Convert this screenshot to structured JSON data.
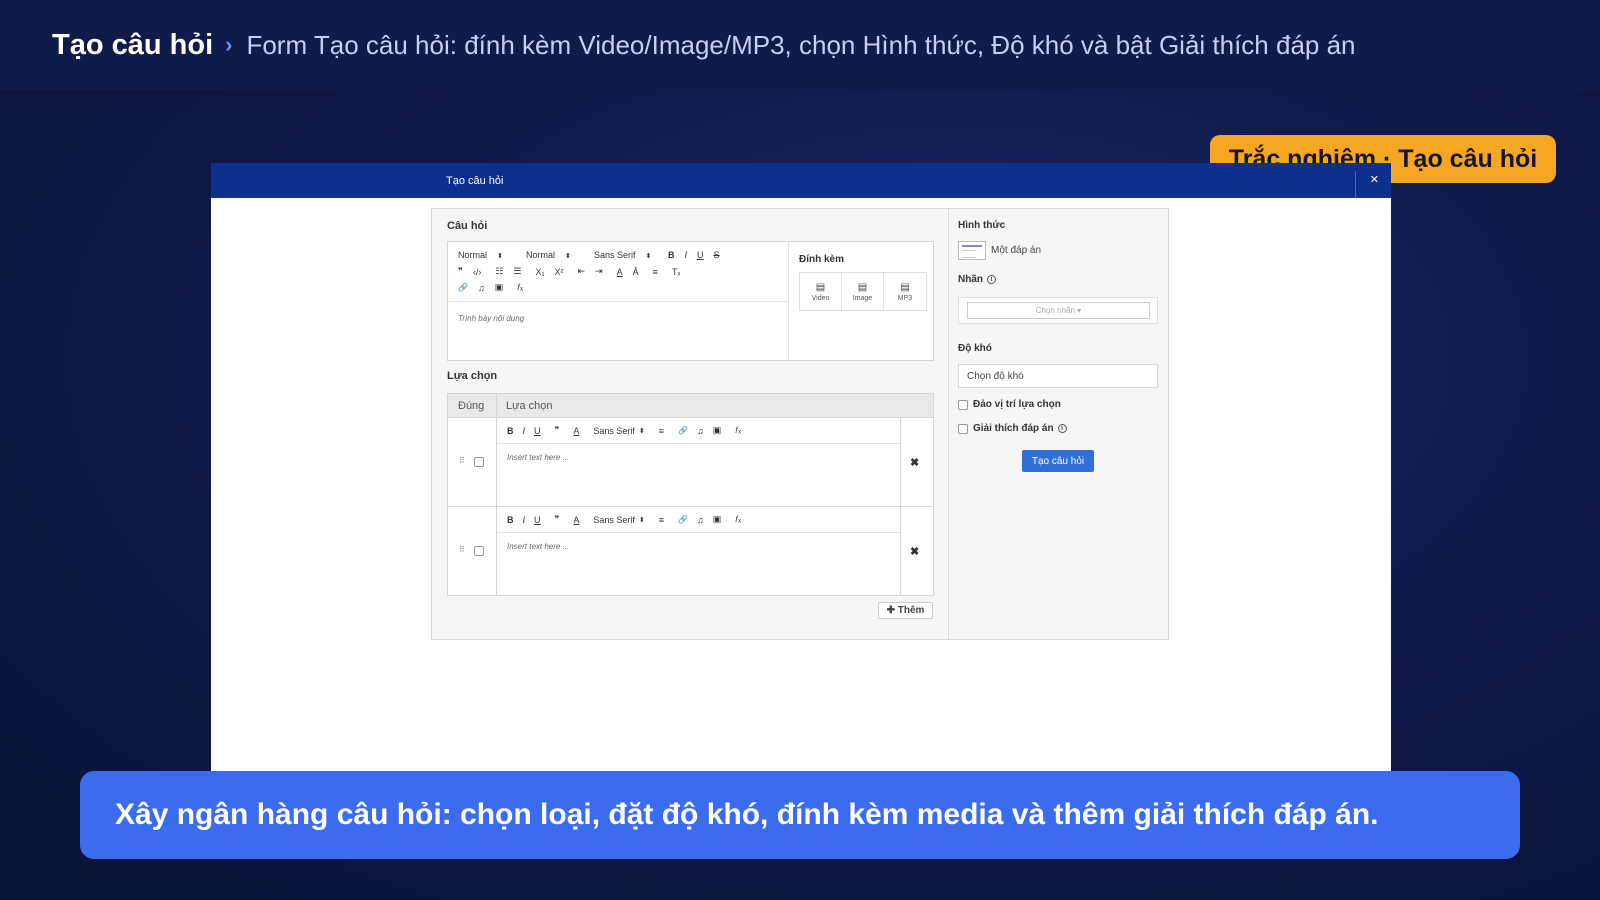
{
  "header": {
    "title": "Tạo câu hỏi",
    "chevron": "›",
    "description": "Form Tạo câu hỏi: đính kèm Video/Image/MP3, chọn Hình thức, Độ khó và bật Giải thích đáp án"
  },
  "badge": {
    "label": "Trắc nghiệm · Tạo câu hỏi"
  },
  "window": {
    "title": "Tạo câu hỏi",
    "close": "✕"
  },
  "question": {
    "label": "Câu hỏi",
    "toolbar": {
      "header_select": "Normal",
      "size_select": "Normal",
      "font_select": "Sans Serif",
      "bold": "B",
      "italic": "I",
      "underline": "U",
      "strike": "S",
      "quote": "❞",
      "code": "‹/›",
      "ordered_list": "☷",
      "bullet_list": "☰",
      "subscript": "X₁",
      "superscript": "X²",
      "outdent": "⇤",
      "indent": "⇥",
      "font_color": "A",
      "background": "Ā",
      "align": "≡",
      "clean": "Tₓ",
      "link": "🔗",
      "audio": "♫",
      "image": "▣",
      "formula": "𝑓ₓ"
    },
    "placeholder": "Trình bày nội dung"
  },
  "attachments": {
    "label": "Đính kèm",
    "buttons": [
      {
        "icon": "video-file-icon",
        "glyph": "▤",
        "label": "Video"
      },
      {
        "icon": "image-file-icon",
        "glyph": "▤",
        "label": "Image"
      },
      {
        "icon": "audio-file-icon",
        "glyph": "▤",
        "label": "MP3"
      }
    ]
  },
  "choices": {
    "label": "Lựa chọn",
    "columns": [
      "Đúng",
      "Lựa chọn"
    ],
    "toolbar": {
      "bold": "B",
      "italic": "I",
      "underline": "U",
      "quote": "❞",
      "font_color": "A",
      "font_select": "Sans Serif",
      "align": "≡",
      "link": "🔗",
      "audio": "♫",
      "image": "▣",
      "formula": "𝑓ₓ"
    },
    "rows": [
      {
        "placeholder": "Insert text here ...",
        "handle": "⠿",
        "remove": "✖"
      },
      {
        "placeholder": "Insert text here ...",
        "handle": "⠿",
        "remove": "✖"
      }
    ],
    "add_label": "✚ Thêm"
  },
  "side": {
    "form_type_label": "Hình thức",
    "form_type_value": "Một đáp án",
    "tag_label": "Nhãn",
    "tag_placeholder": "Chọn nhãn ▾",
    "difficulty_label": "Độ khó",
    "difficulty_placeholder": "Chọn độ khó",
    "shuffle_label": "Đảo vị trí lựa chọn",
    "explain_label": "Giải thích đáp án",
    "info_glyph": "i",
    "create_button": "Tạo câu hỏi"
  },
  "caption": {
    "text": "Xây ngân hàng câu hỏi: chọn loại, đặt độ khó, đính kèm media và thêm giải thích đáp án."
  },
  "colors": {
    "header_bg": "#0f1b48",
    "badge": "#f6a623",
    "window_header": "#0d2f8f",
    "primary_button": "#2f6fd8",
    "caption_bg": "#3b6cf0"
  }
}
